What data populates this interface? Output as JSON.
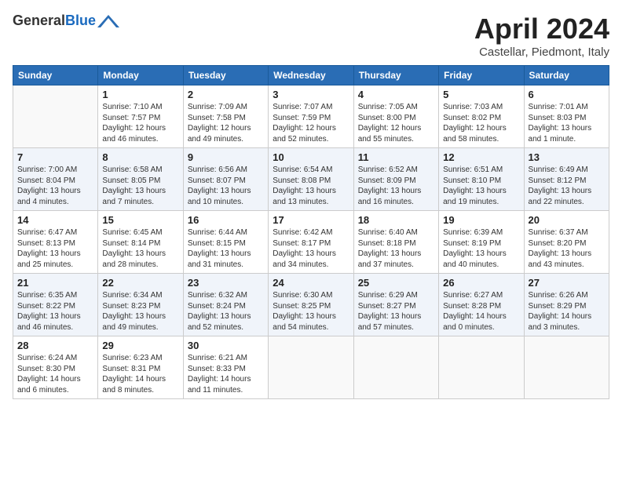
{
  "header": {
    "logo_general": "General",
    "logo_blue": "Blue",
    "month_title": "April 2024",
    "location": "Castellar, Piedmont, Italy"
  },
  "days_of_week": [
    "Sunday",
    "Monday",
    "Tuesday",
    "Wednesday",
    "Thursday",
    "Friday",
    "Saturday"
  ],
  "weeks": [
    {
      "row_class": "normal-row",
      "days": [
        {
          "num": "",
          "info": ""
        },
        {
          "num": "1",
          "info": "Sunrise: 7:10 AM\nSunset: 7:57 PM\nDaylight: 12 hours\nand 46 minutes."
        },
        {
          "num": "2",
          "info": "Sunrise: 7:09 AM\nSunset: 7:58 PM\nDaylight: 12 hours\nand 49 minutes."
        },
        {
          "num": "3",
          "info": "Sunrise: 7:07 AM\nSunset: 7:59 PM\nDaylight: 12 hours\nand 52 minutes."
        },
        {
          "num": "4",
          "info": "Sunrise: 7:05 AM\nSunset: 8:00 PM\nDaylight: 12 hours\nand 55 minutes."
        },
        {
          "num": "5",
          "info": "Sunrise: 7:03 AM\nSunset: 8:02 PM\nDaylight: 12 hours\nand 58 minutes."
        },
        {
          "num": "6",
          "info": "Sunrise: 7:01 AM\nSunset: 8:03 PM\nDaylight: 13 hours\nand 1 minute."
        }
      ]
    },
    {
      "row_class": "alt-row",
      "days": [
        {
          "num": "7",
          "info": "Sunrise: 7:00 AM\nSunset: 8:04 PM\nDaylight: 13 hours\nand 4 minutes."
        },
        {
          "num": "8",
          "info": "Sunrise: 6:58 AM\nSunset: 8:05 PM\nDaylight: 13 hours\nand 7 minutes."
        },
        {
          "num": "9",
          "info": "Sunrise: 6:56 AM\nSunset: 8:07 PM\nDaylight: 13 hours\nand 10 minutes."
        },
        {
          "num": "10",
          "info": "Sunrise: 6:54 AM\nSunset: 8:08 PM\nDaylight: 13 hours\nand 13 minutes."
        },
        {
          "num": "11",
          "info": "Sunrise: 6:52 AM\nSunset: 8:09 PM\nDaylight: 13 hours\nand 16 minutes."
        },
        {
          "num": "12",
          "info": "Sunrise: 6:51 AM\nSunset: 8:10 PM\nDaylight: 13 hours\nand 19 minutes."
        },
        {
          "num": "13",
          "info": "Sunrise: 6:49 AM\nSunset: 8:12 PM\nDaylight: 13 hours\nand 22 minutes."
        }
      ]
    },
    {
      "row_class": "normal-row",
      "days": [
        {
          "num": "14",
          "info": "Sunrise: 6:47 AM\nSunset: 8:13 PM\nDaylight: 13 hours\nand 25 minutes."
        },
        {
          "num": "15",
          "info": "Sunrise: 6:45 AM\nSunset: 8:14 PM\nDaylight: 13 hours\nand 28 minutes."
        },
        {
          "num": "16",
          "info": "Sunrise: 6:44 AM\nSunset: 8:15 PM\nDaylight: 13 hours\nand 31 minutes."
        },
        {
          "num": "17",
          "info": "Sunrise: 6:42 AM\nSunset: 8:17 PM\nDaylight: 13 hours\nand 34 minutes."
        },
        {
          "num": "18",
          "info": "Sunrise: 6:40 AM\nSunset: 8:18 PM\nDaylight: 13 hours\nand 37 minutes."
        },
        {
          "num": "19",
          "info": "Sunrise: 6:39 AM\nSunset: 8:19 PM\nDaylight: 13 hours\nand 40 minutes."
        },
        {
          "num": "20",
          "info": "Sunrise: 6:37 AM\nSunset: 8:20 PM\nDaylight: 13 hours\nand 43 minutes."
        }
      ]
    },
    {
      "row_class": "alt-row",
      "days": [
        {
          "num": "21",
          "info": "Sunrise: 6:35 AM\nSunset: 8:22 PM\nDaylight: 13 hours\nand 46 minutes."
        },
        {
          "num": "22",
          "info": "Sunrise: 6:34 AM\nSunset: 8:23 PM\nDaylight: 13 hours\nand 49 minutes."
        },
        {
          "num": "23",
          "info": "Sunrise: 6:32 AM\nSunset: 8:24 PM\nDaylight: 13 hours\nand 52 minutes."
        },
        {
          "num": "24",
          "info": "Sunrise: 6:30 AM\nSunset: 8:25 PM\nDaylight: 13 hours\nand 54 minutes."
        },
        {
          "num": "25",
          "info": "Sunrise: 6:29 AM\nSunset: 8:27 PM\nDaylight: 13 hours\nand 57 minutes."
        },
        {
          "num": "26",
          "info": "Sunrise: 6:27 AM\nSunset: 8:28 PM\nDaylight: 14 hours\nand 0 minutes."
        },
        {
          "num": "27",
          "info": "Sunrise: 6:26 AM\nSunset: 8:29 PM\nDaylight: 14 hours\nand 3 minutes."
        }
      ]
    },
    {
      "row_class": "normal-row",
      "days": [
        {
          "num": "28",
          "info": "Sunrise: 6:24 AM\nSunset: 8:30 PM\nDaylight: 14 hours\nand 6 minutes."
        },
        {
          "num": "29",
          "info": "Sunrise: 6:23 AM\nSunset: 8:31 PM\nDaylight: 14 hours\nand 8 minutes."
        },
        {
          "num": "30",
          "info": "Sunrise: 6:21 AM\nSunset: 8:33 PM\nDaylight: 14 hours\nand 11 minutes."
        },
        {
          "num": "",
          "info": ""
        },
        {
          "num": "",
          "info": ""
        },
        {
          "num": "",
          "info": ""
        },
        {
          "num": "",
          "info": ""
        }
      ]
    }
  ]
}
